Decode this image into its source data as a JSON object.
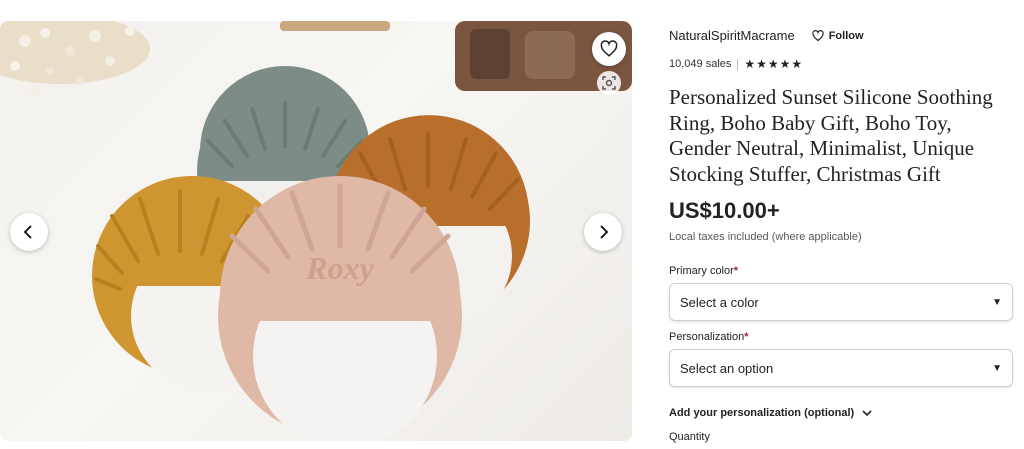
{
  "gallery": {
    "photo_text": "Roxy",
    "prev_icon": "chevron-left-icon",
    "next_icon": "chevron-right-icon",
    "favorite_icon": "heart-icon",
    "visual_search_icon": "visual-search-icon"
  },
  "shop": {
    "name": "NaturalSpiritMacrame",
    "follow_label": "Follow",
    "sales": "10,049 sales",
    "stars": "★★★★★",
    "rating": 5
  },
  "listing": {
    "title": "Personalized Sunset Silicone Soothing Ring, Boho Baby Gift, Boho Toy, Gender Neutral, Minimalist, Unique Stocking Stuffer, Christmas Gift",
    "price": "US$10.00+",
    "tax_note": "Local taxes included (where applicable)"
  },
  "options": {
    "primary_color_label": "Primary color",
    "primary_color_value": "Select a color",
    "personalization_label": "Personalization",
    "personalization_value": "Select an option",
    "required_mark": "*",
    "add_personalization": "Add your personalization (optional)",
    "quantity_label": "Quantity"
  },
  "colors": {
    "required": "#a61a2e",
    "ring_sage": "#7d8c86",
    "ring_rust": "#b86f2b",
    "ring_mustard": "#cf9530",
    "ring_blush": "#dfb8a6"
  }
}
